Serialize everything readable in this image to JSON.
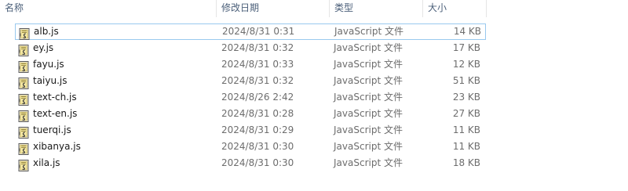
{
  "columns": {
    "name": "名称",
    "modified": "修改日期",
    "type": "类型",
    "size": "大小"
  },
  "files": [
    {
      "name": "alb.js",
      "modified": "2024/8/31 0:31",
      "type": "JavaScript 文件",
      "size": "14 KB",
      "selected": true
    },
    {
      "name": "ey.js",
      "modified": "2024/8/31 0:32",
      "type": "JavaScript 文件",
      "size": "17 KB"
    },
    {
      "name": "fayu.js",
      "modified": "2024/8/31 0:33",
      "type": "JavaScript 文件",
      "size": "12 KB"
    },
    {
      "name": "taiyu.js",
      "modified": "2024/8/31 0:32",
      "type": "JavaScript 文件",
      "size": "51 KB"
    },
    {
      "name": "text-ch.js",
      "modified": "2024/8/26 2:42",
      "type": "JavaScript 文件",
      "size": "23 KB"
    },
    {
      "name": "text-en.js",
      "modified": "2024/8/31 0:28",
      "type": "JavaScript 文件",
      "size": "27 KB"
    },
    {
      "name": "tuerqi.js",
      "modified": "2024/8/31 0:29",
      "type": "JavaScript 文件",
      "size": "11 KB"
    },
    {
      "name": "xibanya.js",
      "modified": "2024/8/31 0:30",
      "type": "JavaScript 文件",
      "size": "11 KB"
    },
    {
      "name": "xila.js",
      "modified": "2024/8/31 0:30",
      "type": "JavaScript 文件",
      "size": "18 KB"
    }
  ],
  "icon": "javascript-file-icon",
  "colors": {
    "header_text": "#4c607a",
    "selection_border": "#99c9ef",
    "detail_text": "#6d6d6d"
  }
}
